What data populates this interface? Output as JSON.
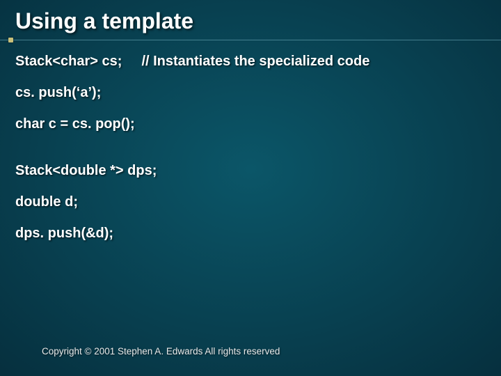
{
  "title": "Using a template",
  "code": {
    "l1a": "Stack<char> cs;",
    "l1b": "// Instantiates the specialized code",
    "l2": "cs. push(‘a’);",
    "l3": "char c = cs. pop();",
    "l4": "Stack<double *> dps;",
    "l5": "double d;",
    "l6": "dps. push(&d);"
  },
  "footer": "Copyright © 2001 Stephen A. Edwards  All rights reserved"
}
